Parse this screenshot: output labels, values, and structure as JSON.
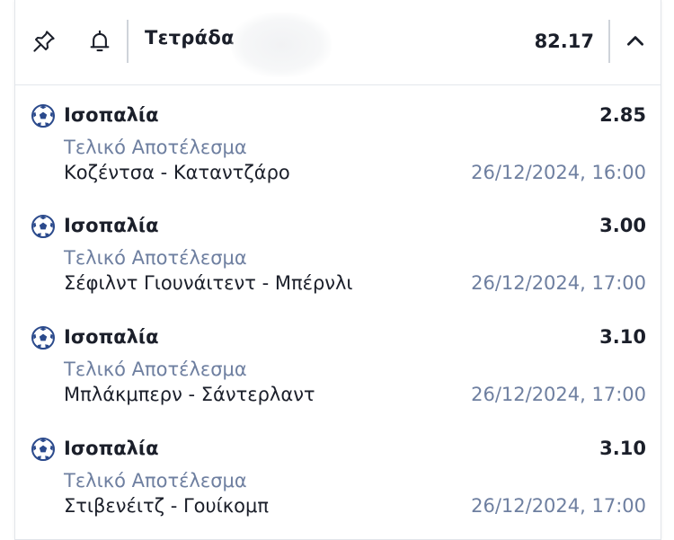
{
  "header": {
    "title": "Τετράδα",
    "total_odds": "82.17",
    "icons": {
      "pin": "pin-icon",
      "bell": "bell-icon",
      "collapse": "chevron-up-icon"
    }
  },
  "colors": {
    "text_primary": "#1b1f2a",
    "text_secondary": "#6e7fa0",
    "ball_blue": "#2b4a8c"
  },
  "selections": [
    {
      "pick": "Ισοπαλία",
      "odds": "2.85",
      "market": "Τελικό Αποτέλεσμα",
      "match": "Κοζέντσα - Καταντζάρο",
      "datetime": "26/12/2024, 16:00",
      "sport_icon": "soccer-ball-icon"
    },
    {
      "pick": "Ισοπαλία",
      "odds": "3.00",
      "market": "Τελικό Αποτέλεσμα",
      "match": "Σέφιλντ Γιουνάιτεντ - Μπέρνλι",
      "datetime": "26/12/2024, 17:00",
      "sport_icon": "soccer-ball-icon"
    },
    {
      "pick": "Ισοπαλία",
      "odds": "3.10",
      "market": "Τελικό Αποτέλεσμα",
      "match": "Μπλάκμπερν - Σάντερλαντ",
      "datetime": "26/12/2024, 17:00",
      "sport_icon": "soccer-ball-icon"
    },
    {
      "pick": "Ισοπαλία",
      "odds": "3.10",
      "market": "Τελικό Αποτέλεσμα",
      "match": "Στιβενέιτζ - Γουίκομπ",
      "datetime": "26/12/2024, 17:00",
      "sport_icon": "soccer-ball-icon"
    }
  ]
}
